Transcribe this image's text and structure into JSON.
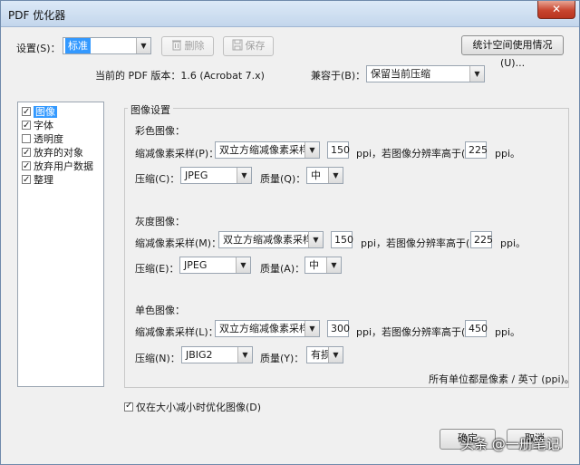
{
  "window": {
    "title": "PDF 优化器",
    "close_symbol": "✕"
  },
  "top": {
    "settings_label": "设置(S)：",
    "settings_value": "标准",
    "delete_label": "删除",
    "save_label": "保存",
    "audit_label": "统计空间使用情况(U)...",
    "version_text": "当前的 PDF 版本：1.6 (Acrobat 7.x)",
    "compat_label": "兼容于(B)：",
    "compat_value": "保留当前压缩"
  },
  "sidebar": {
    "items": [
      {
        "label": "图像",
        "checked": true
      },
      {
        "label": "字体",
        "checked": true
      },
      {
        "label": "透明度",
        "checked": false
      },
      {
        "label": "放弃的对象",
        "checked": true
      },
      {
        "label": "放弃用户数据",
        "checked": true
      },
      {
        "label": "整理",
        "checked": true
      }
    ]
  },
  "image_settings": {
    "title": "图像设置",
    "color": {
      "heading": "彩色图像：",
      "downsample_label": "缩减像素采样(P)：",
      "downsample_value": "双立方缩减像素采样至",
      "ppi_value": "150",
      "ppi_text": "ppi，若图像分辨率高于(F)",
      "above_value": "225",
      "ppi_suffix": "ppi。",
      "compression_label": "压缩(C)：",
      "compression_value": "JPEG",
      "quality_label": "质量(Q)：",
      "quality_value": "中"
    },
    "gray": {
      "heading": "灰度图像：",
      "downsample_label": "缩减像素采样(M)：",
      "downsample_value": "双立方缩减像素采样至",
      "ppi_value": "150",
      "ppi_text": "ppi，若图像分辨率高于(O)",
      "above_value": "225",
      "ppi_suffix": "ppi。",
      "compression_label": "压缩(E)：",
      "compression_value": "JPEG",
      "quality_label": "质量(A)：",
      "quality_value": "中"
    },
    "mono": {
      "heading": "单色图像：",
      "downsample_label": "缩减像素采样(L)：",
      "downsample_value": "双立方缩减像素采样至",
      "ppi_value": "300",
      "ppi_text": "ppi，若图像分辨率高于(R)",
      "above_value": "450",
      "ppi_suffix": "ppi。",
      "compression_label": "压缩(N)：",
      "compression_value": "JBIG2",
      "quality_label": "质量(Y)：",
      "quality_value": "有损"
    },
    "units_note": "所有单位都是像素 / 英寸 (ppi)。"
  },
  "bottom": {
    "optimize_checkbox": "仅在大小减小时优化图像(D)",
    "optimize_checked": true,
    "ok_label": "确定",
    "cancel_label": "取消"
  },
  "watermark_text": "头条 @一册笔记"
}
